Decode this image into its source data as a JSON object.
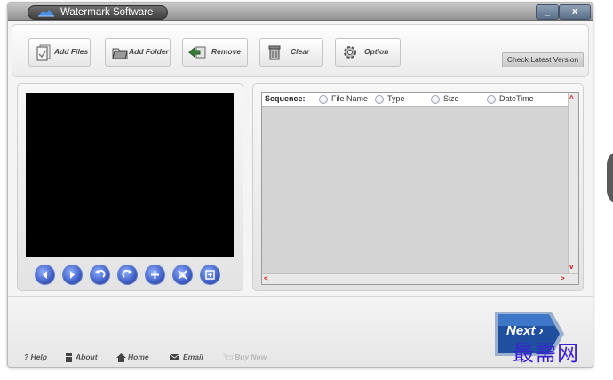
{
  "window": {
    "title": "Watermark Software",
    "minimize_label": "_",
    "close_label": "x"
  },
  "toolbar": {
    "add_files": "Add Files",
    "add_folder": "Add Folder",
    "remove": "Remove",
    "clear": "Clear",
    "option": "Option",
    "check_version": "Check Latest Version"
  },
  "player": {
    "controls": [
      {
        "name": "previous",
        "icon": "arrow-left-icon"
      },
      {
        "name": "next",
        "icon": "arrow-right-icon"
      },
      {
        "name": "rotate-left",
        "icon": "rotate-left-icon"
      },
      {
        "name": "rotate-right",
        "icon": "rotate-right-icon"
      },
      {
        "name": "zoom-in",
        "icon": "zoom-in-icon"
      },
      {
        "name": "actual-size",
        "icon": "actual-size-icon"
      },
      {
        "name": "fit",
        "icon": "fit-icon"
      }
    ]
  },
  "list": {
    "sequence_label": "Sequence:",
    "options": [
      "File Name",
      "Type",
      "Size",
      "DateTime"
    ]
  },
  "footer": {
    "next": "Next",
    "help": "Help",
    "about": "About",
    "home": "Home",
    "email": "Email",
    "buy_now": "Buy Now"
  },
  "overlay": {
    "watermark_text": "最需网"
  },
  "colors": {
    "accent_blue": "#2f5fb8",
    "watermark_purple": "#3b1fd6",
    "scroll_arrow": "#c81818"
  }
}
